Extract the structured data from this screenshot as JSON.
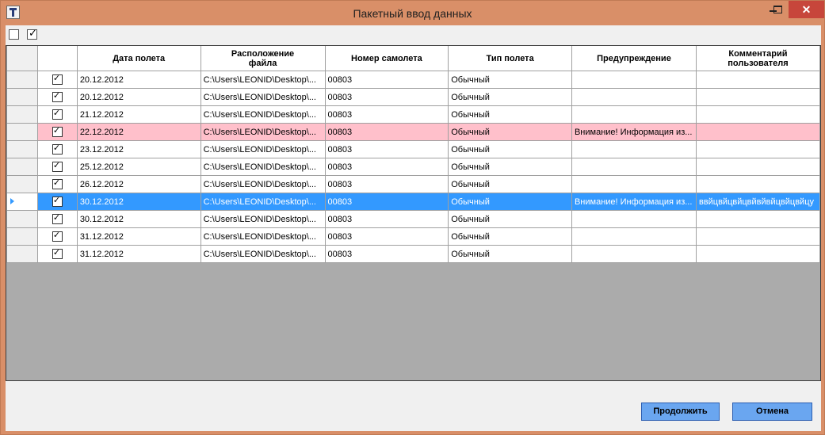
{
  "window": {
    "title": "Пакетный ввод данных"
  },
  "columns": [
    "Дата полета",
    "Расположение файла",
    "Номер самолета",
    "Тип полета",
    "Предупреждение",
    "Комментарий пользователя"
  ],
  "rows": [
    {
      "date": "20.12.2012",
      "file": "C:\\Users\\LEONID\\Desktop\\...",
      "plane": "00803",
      "type": "Обычный",
      "warning": "",
      "comment": "",
      "checked": true,
      "state": "normal"
    },
    {
      "date": "20.12.2012",
      "file": "C:\\Users\\LEONID\\Desktop\\...",
      "plane": "00803",
      "type": "Обычный",
      "warning": "",
      "comment": "",
      "checked": true,
      "state": "normal"
    },
    {
      "date": "21.12.2012",
      "file": "C:\\Users\\LEONID\\Desktop\\...",
      "plane": "00803",
      "type": "Обычный",
      "warning": "",
      "comment": "",
      "checked": true,
      "state": "normal"
    },
    {
      "date": "22.12.2012",
      "file": "C:\\Users\\LEONID\\Desktop\\...",
      "plane": "00803",
      "type": "Обычный",
      "warning": "Внимание! Информация из...",
      "comment": "",
      "checked": true,
      "state": "warning"
    },
    {
      "date": "23.12.2012",
      "file": "C:\\Users\\LEONID\\Desktop\\...",
      "plane": "00803",
      "type": "Обычный",
      "warning": "",
      "comment": "",
      "checked": true,
      "state": "normal"
    },
    {
      "date": "25.12.2012",
      "file": "C:\\Users\\LEONID\\Desktop\\...",
      "plane": "00803",
      "type": "Обычный",
      "warning": "",
      "comment": "",
      "checked": true,
      "state": "normal"
    },
    {
      "date": "26.12.2012",
      "file": "C:\\Users\\LEONID\\Desktop\\...",
      "plane": "00803",
      "type": "Обычный",
      "warning": "",
      "comment": "",
      "checked": true,
      "state": "normal"
    },
    {
      "date": "30.12.2012",
      "file": "C:\\Users\\LEONID\\Desktop\\...",
      "plane": "00803",
      "type": "Обычный",
      "warning": "Внимание! Информация из...",
      "comment": "ввйцвйцвйцвйвйвйцвйцвйцу",
      "checked": true,
      "state": "selected"
    },
    {
      "date": "30.12.2012",
      "file": "C:\\Users\\LEONID\\Desktop\\...",
      "plane": "00803",
      "type": "Обычный",
      "warning": "",
      "comment": "",
      "checked": true,
      "state": "normal"
    },
    {
      "date": "31.12.2012",
      "file": "C:\\Users\\LEONID\\Desktop\\...",
      "plane": "00803",
      "type": "Обычный",
      "warning": "",
      "comment": "",
      "checked": true,
      "state": "normal"
    },
    {
      "date": "31.12.2012",
      "file": "C:\\Users\\LEONID\\Desktop\\...",
      "plane": "00803",
      "type": "Обычный",
      "warning": "",
      "comment": "",
      "checked": true,
      "state": "normal"
    }
  ],
  "buttons": {
    "continue": "Продолжить",
    "cancel": "Отмена"
  },
  "colors": {
    "title_bar": "#d98f68",
    "warning_row": "#ffc0cb",
    "selected_row": "#3399ff",
    "grid_empty": "#ababab",
    "button": "#6aa6f0"
  }
}
